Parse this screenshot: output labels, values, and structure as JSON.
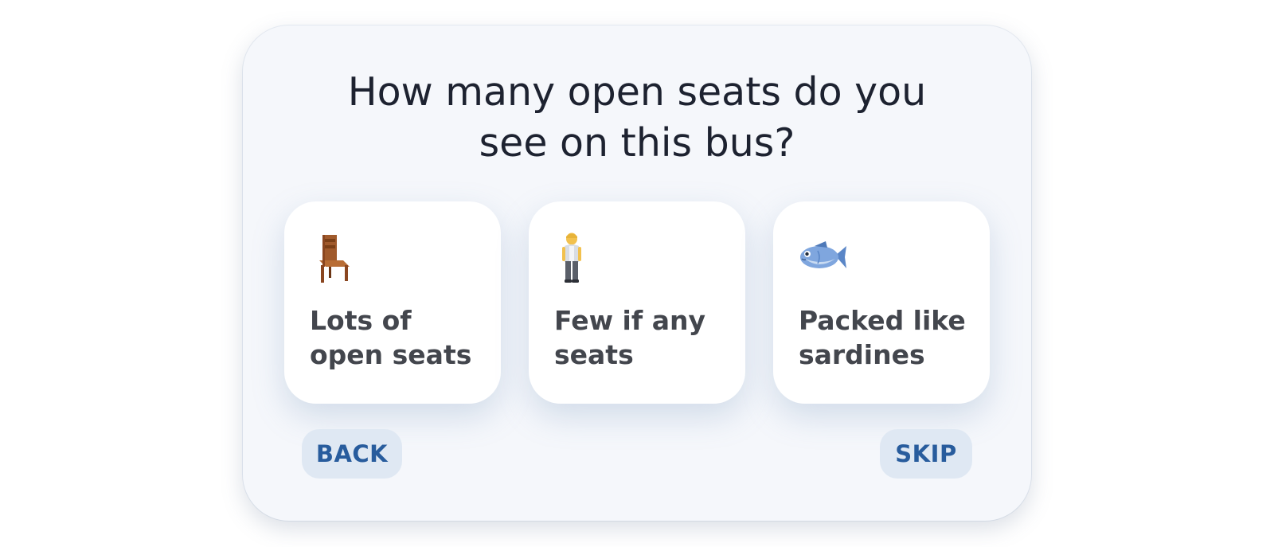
{
  "prompt": {
    "title_line1": "How many open seats do you",
    "title_line2": "see on this bus?"
  },
  "options": [
    {
      "icon": "chair-icon",
      "label_line1": "Lots of",
      "label_line2": "open seats"
    },
    {
      "icon": "standing-person-icon",
      "label_line1": "Few if any",
      "label_line2": "seats"
    },
    {
      "icon": "fish-icon",
      "label_line1": "Packed like",
      "label_line2": "sardines"
    }
  ],
  "navigation": {
    "back_label": "BACK",
    "skip_label": "SKIP"
  },
  "colors": {
    "modal_background": "#f5f7fb",
    "card_background": "#ffffff",
    "title_text": "#1d2230",
    "option_text": "#43464d",
    "button_background": "#dfe8f3",
    "button_text": "#285c9d"
  }
}
